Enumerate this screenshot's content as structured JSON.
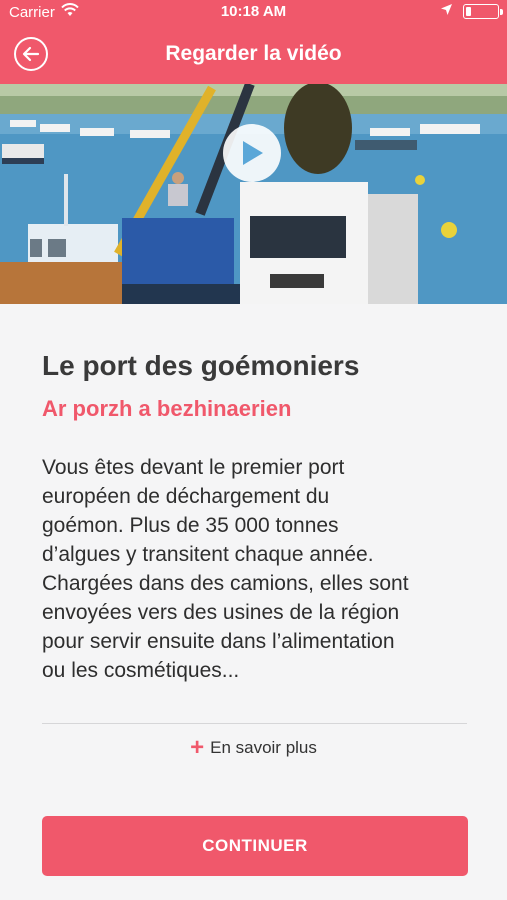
{
  "status_bar": {
    "carrier": "Carrier",
    "time": "10:18 AM",
    "icons": [
      "wifi-icon",
      "location-arrow-icon",
      "battery-icon"
    ]
  },
  "nav": {
    "title": "Regarder la vidéo",
    "back_icon": "arrow-left-circle-icon"
  },
  "video": {
    "play_icon": "play-icon",
    "scene": "harbor-truck-crane"
  },
  "content": {
    "title": "Le port des goémoniers",
    "subtitle": "Ar porzh a bezhinaerien",
    "body": "Vous êtes devant le premier port\neuropéen de déchargement du\ngoémon. Plus de 35 000 tonnes\nd’algues y transitent chaque année.\nChargées dans des camions, elles sont\nenvoyées vers des usines de la région\npour servir ensuite dans l’alimentation\nou les cosmétiques...",
    "more_label": "En savoir plus",
    "continue_label": "CONTINUER"
  },
  "colors": {
    "accent": "#f0586b",
    "background": "#f5f5f6",
    "title_text": "#3a3a3a"
  }
}
